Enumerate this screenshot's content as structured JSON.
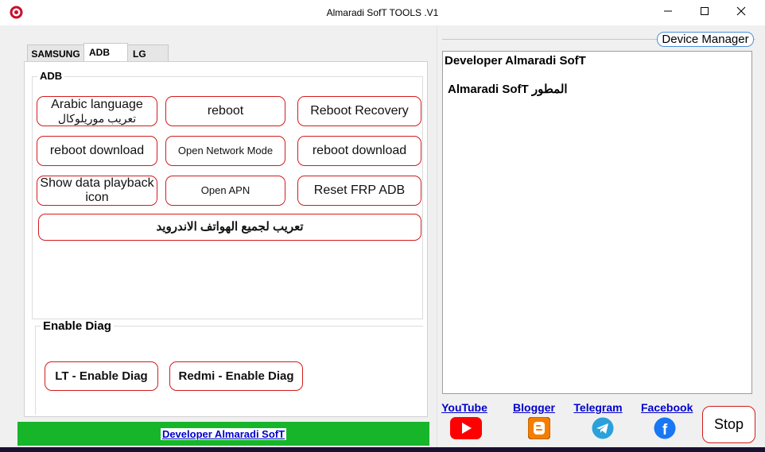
{
  "window": {
    "title": "Almaradi SofT TOOLS .V1"
  },
  "tabs": [
    {
      "label": "SAMSUNG"
    },
    {
      "label": "ADB"
    },
    {
      "label": "LG"
    }
  ],
  "adb_group": {
    "label": "ADB",
    "buttons": {
      "arabic_line1": "Arabic language",
      "arabic_line2": "تعريب موريلوكال",
      "reboot": "reboot",
      "reboot_recovery": "Reboot Recovery",
      "reboot_download_1": "reboot download",
      "open_network_mode": "Open Network Mode",
      "reboot_download_2": "reboot download",
      "show_playback_line1": "Show data playback",
      "show_playback_line2": "icon",
      "open_apn": "Open APN",
      "reset_frp": "Reset FRP  ADB",
      "arabize_all": "تعريب  لجميع الهواتف الاندرويد"
    }
  },
  "diag_group": {
    "label": "Enable Diag",
    "buttons": {
      "lt": "LT -  Enable Diag",
      "redmi": "Redmi -  Enable Diag"
    }
  },
  "device_manager": {
    "label": "Device Manager"
  },
  "log": {
    "line1": "Developer Almaradi SofT",
    "line2": "Almaradi SofT  المطور"
  },
  "links": {
    "youtube": "YouTube",
    "blogger": "Blogger",
    "telegram": "Telegram",
    "facebook": "Facebook"
  },
  "stop": {
    "label": "Stop"
  },
  "status": {
    "text": "Developer Almaradi SofT"
  },
  "colors": {
    "button_border": "#d21c1c",
    "status_bar": "#17b52a",
    "link": "#0000cc",
    "youtube": "#ff0000",
    "blogger": "#f57d00",
    "telegram": "#2aa1da",
    "facebook": "#1877f2"
  },
  "icons": {
    "app": "app-logo-icon",
    "minimize": "minimize-icon",
    "maximize": "maximize-icon",
    "close": "close-icon"
  }
}
